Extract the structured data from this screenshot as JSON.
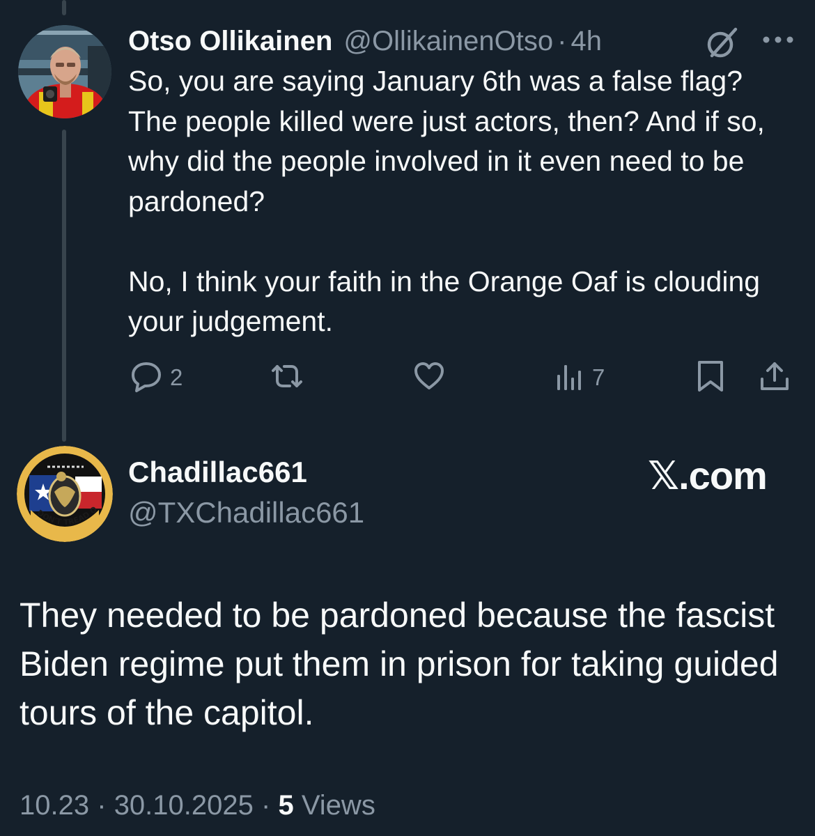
{
  "reply": {
    "author_name": "Otso Ollikainen",
    "author_handle": "@OllikainenOtso",
    "separator": "·",
    "time_ago": "4h",
    "text": "So, you are saying January 6th was a false flag? The people killed were just actors, then? And if so, why did the people involved in it even need to be pardoned?\n\nNo, I think your faith in the Orange Oaf is clouding your judgement.",
    "actions": {
      "reply_count": "2",
      "repost_count": "",
      "like_count": "",
      "views_count": "7"
    }
  },
  "main_post": {
    "author_name": "Chadillac661",
    "author_handle": "@TXChadillac661",
    "watermark": "𝕏.com",
    "avatar_text": "DON'T TREAD ON ME",
    "text": "They needed to be pardoned because the fascist Biden regime put them in prison for taking guided tours of the capitol.",
    "time": "10.23",
    "separator": "·",
    "date": "30.10.2025",
    "views_count": "5",
    "views_label": "Views"
  },
  "icons": {
    "reply": "speech-bubble-icon",
    "repost": "repost-arrows-icon",
    "like": "heart-icon",
    "views": "bar-chart-icon",
    "bookmark": "bookmark-icon",
    "share": "share-upload-icon",
    "grok": "grok-slash-icon",
    "more": "ellipsis-icon"
  },
  "colors": {
    "background": "#15202b",
    "text_primary": "#f7f9f9",
    "text_secondary": "#8b98a5",
    "thread_line": "#38444d"
  }
}
